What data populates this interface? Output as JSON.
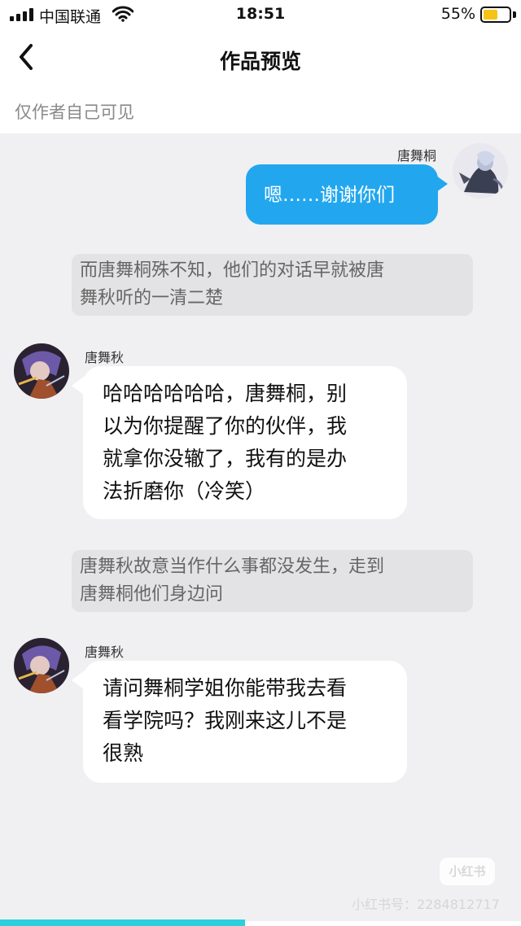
{
  "status_bar": {
    "carrier": "中国联通",
    "time": "18:51",
    "battery_percent_label": "55%",
    "battery_level": 0.55,
    "signal_icon": "signal-bars-icon",
    "wifi_icon": "wifi-icon",
    "battery_icon": "battery-icon",
    "battery_color": "#f6c415"
  },
  "nav": {
    "back_icon": "chevron-left-icon",
    "title": "作品预览"
  },
  "visibility_note": "仅作者自己可见",
  "messages": [
    {
      "type": "outgoing",
      "sender": "唐舞桐",
      "text": "嗯……谢谢你们",
      "bubble_color": "#22a7ef"
    },
    {
      "type": "narration",
      "lines": [
        "而唐舞桐殊不知，他们的对话早就被唐",
        "舞秋听的一清二楚"
      ]
    },
    {
      "type": "incoming",
      "sender": "唐舞秋",
      "lines": [
        "哈哈哈哈哈哈，唐舞桐，别",
        "以为你提醒了你的伙伴，我",
        "就拿你没辙了，我有的是办",
        "法折磨你（冷笑）"
      ]
    },
    {
      "type": "narration",
      "lines": [
        "唐舞秋故意当作什么事都没发生，走到",
        "唐舞桐他们身边问"
      ]
    },
    {
      "type": "incoming",
      "sender": "唐舞秋",
      "lines": [
        "请问舞桐学姐你能带我去看",
        "看学院吗？我刚来这儿不是",
        "很熟"
      ]
    }
  ],
  "watermark": {
    "logo": "小红书",
    "account": "小红书号：2284812717"
  },
  "progress": {
    "fraction": 0.47,
    "color": "#2bd0dc"
  }
}
